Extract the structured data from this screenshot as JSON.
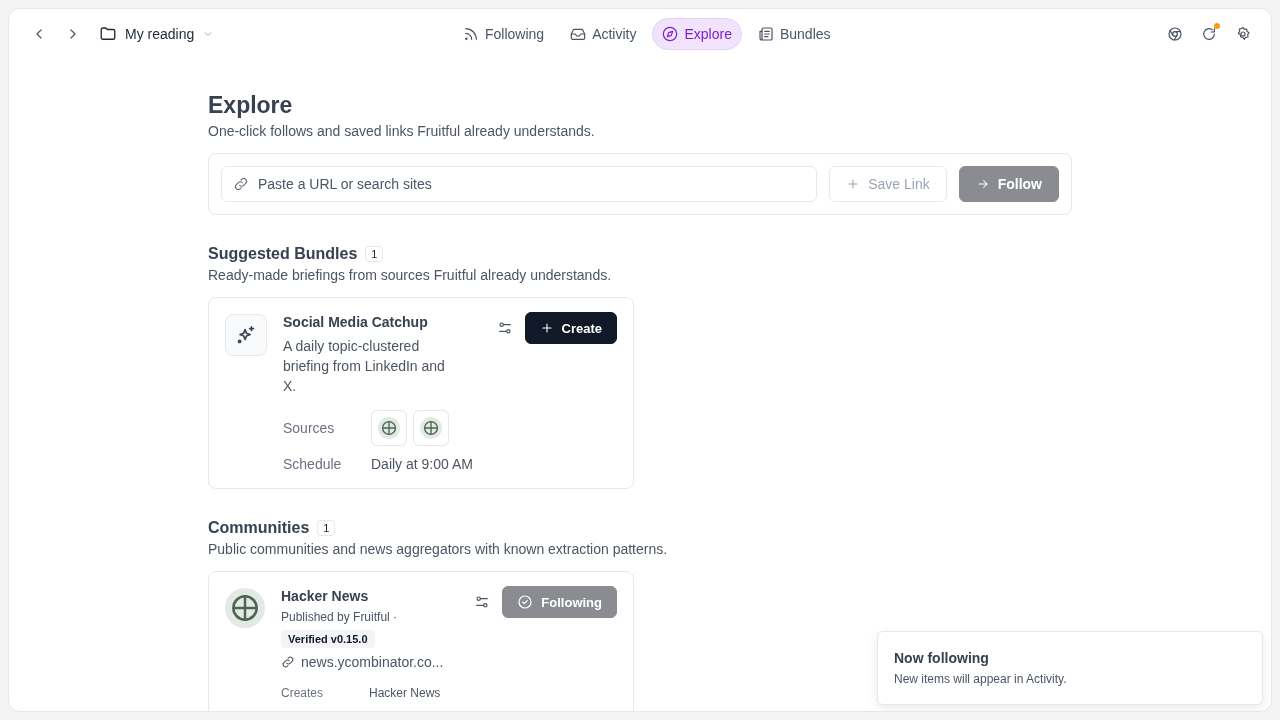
{
  "topbar": {
    "folder": "My reading",
    "tabs": [
      {
        "label": "Following",
        "selected": false
      },
      {
        "label": "Activity",
        "selected": false
      },
      {
        "label": "Explore",
        "selected": true
      },
      {
        "label": "Bundles",
        "selected": false
      }
    ],
    "refresh_dot": true
  },
  "header": {
    "title": "Explore",
    "subtitle": "One-click follows and saved links Fruitful already understands."
  },
  "url_bar": {
    "placeholder": "Paste a URL or search sites",
    "save_button": {
      "label": "Save Link",
      "disabled": true
    },
    "follow_button": {
      "label": "Follow",
      "disabled": true
    }
  },
  "bundles": {
    "title": "Suggested Bundles",
    "count": "1",
    "subtitle": "Ready-made briefings from sources Fruitful already understands.",
    "items": [
      {
        "name": "Social Media Catchup",
        "description": "A daily topic-clustered briefing from LinkedIn and X.",
        "action": "Create",
        "sources_label": "Sources",
        "sources": [
          {
            "kind": "globe"
          },
          {
            "kind": "globe"
          }
        ],
        "schedule_label": "Schedule",
        "schedule": "Daily at 9:00 AM"
      }
    ]
  },
  "communities": {
    "title": "Communities",
    "count": "1",
    "subtitle": "Public communities and news aggregators with known extraction patterns.",
    "items": [
      {
        "name": "Hacker News",
        "publisher": "Published by Fruitful ·",
        "badge": "Verified v0.15.0",
        "url": "news.ycombinator.co...",
        "action": "Following",
        "following": true,
        "creates_label": "Creates",
        "creates": "Hacker News"
      }
    ]
  },
  "toast": {
    "title": "Now following",
    "message": "New items will appear in Activity."
  }
}
